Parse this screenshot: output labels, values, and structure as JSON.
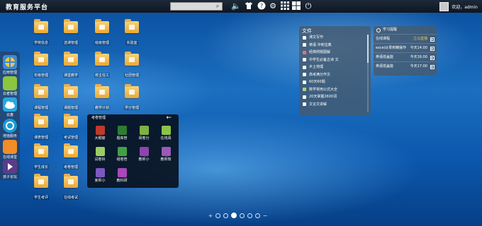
{
  "topbar": {
    "title": "教育服务平台",
    "search_placeholder": "",
    "welcome": "欢迎，admin",
    "icons": [
      "search-icon",
      "volume-icon",
      "shirt-icon",
      "help-icon",
      "settings-icon",
      "apps-grid-icon",
      "windows-icon",
      "power-icon"
    ]
  },
  "dock": {
    "items": [
      {
        "label": "应用管理",
        "icon": "app-manage-icon",
        "color": "#3a8ad6"
      },
      {
        "label": "云者管理",
        "icon": "cloud-manage-icon",
        "color": "#8cc63f"
      },
      {
        "label": "云盘",
        "icon": "cloud-icon",
        "color": "#2aa7e0"
      },
      {
        "label": "增值服务",
        "icon": "sync-icon",
        "color": "#1b9ad6"
      },
      {
        "label": "在线课堂",
        "icon": "classroom-icon",
        "color": "#f28c28"
      },
      {
        "label": "孩子论坛",
        "icon": "forum-icon",
        "color": "#5a3d8a"
      }
    ]
  },
  "desktop": {
    "icons": [
      {
        "label": "学校信息"
      },
      {
        "label": "年级管理"
      },
      {
        "label": "课程管理"
      },
      {
        "label": "课表管理"
      },
      {
        "label": "学生成长"
      },
      {
        "label": "学生考评"
      },
      {
        "label": "选课管理"
      },
      {
        "label": "课堂教学"
      },
      {
        "label": "课题管理"
      },
      {
        "label": "考试管理"
      },
      {
        "label": "考卷管理"
      },
      {
        "label": "在线考试"
      },
      {
        "label": "班级管理"
      },
      {
        "label": "校主任工"
      },
      {
        "label": "教学计划"
      },
      {
        "label": "实验室"
      },
      {
        "label": "社团管理"
      },
      {
        "label": "学分管理"
      }
    ]
  },
  "popup": {
    "title": "考卷管理",
    "back": "←",
    "items": [
      {
        "label": "大纲窗",
        "color": "#c0392b"
      },
      {
        "label": "题库管",
        "color": "#2e7d32"
      },
      {
        "label": "阅卷分",
        "color": "#7cb342"
      },
      {
        "label": "在线阅",
        "color": "#8bc34a"
      },
      {
        "label": "试卷铃",
        "color": "#9ccc65"
      },
      {
        "label": "组卷管",
        "color": "#43a047"
      },
      {
        "label": "教师小",
        "color": "#8e44ad"
      },
      {
        "label": "教师知",
        "color": "#9b59b6"
      },
      {
        "label": "家师小",
        "color": "#7e57c2"
      },
      {
        "label": "教科研",
        "color": "#ab47bc"
      }
    ]
  },
  "files": {
    "title": "文件",
    "items": [
      "课文写作",
      "英语 冲刺宝典",
      "经典例题图解",
      "中学生必备古诗 文",
      "乡土地理",
      "高考满分作文",
      "60天60题",
      "数学常用公式大全",
      "20天掌握2600词",
      "文言文讲解"
    ]
  },
  "study": {
    "title": "学习提醒",
    "rows": [
      {
        "name": "在线课程",
        "time": "立马直播"
      },
      {
        "name": "excel从零到精操作",
        "time": "今天14:00"
      },
      {
        "name": "英语低盖能",
        "time": "今天16:00"
      },
      {
        "name": "英语低盖能",
        "time": "今天17:00"
      }
    ]
  },
  "pager": {
    "plus": "+",
    "minus": "−",
    "pages": 6,
    "active": 2
  }
}
